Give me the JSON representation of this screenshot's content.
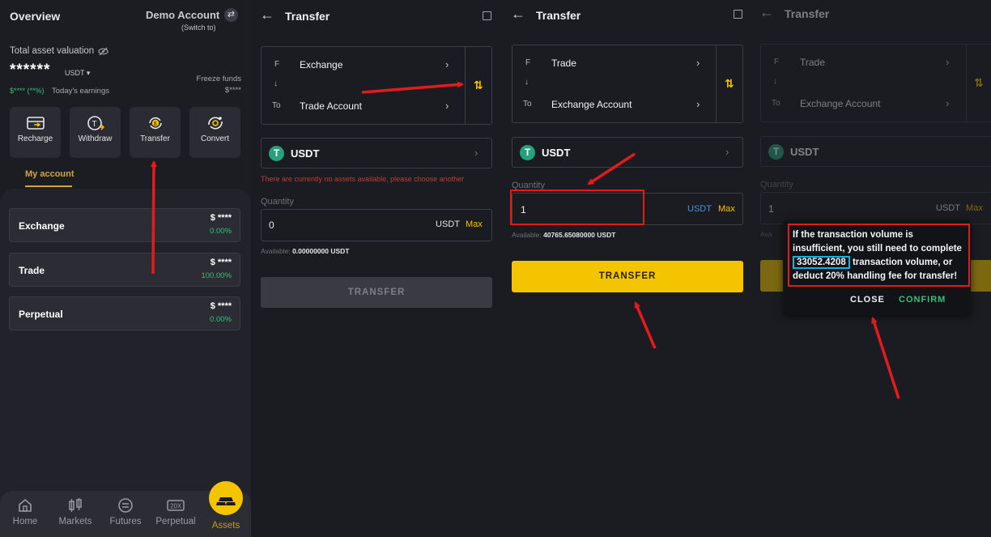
{
  "overview": {
    "title": "Overview",
    "account_name": "Demo Account",
    "switch_label": "(Switch to)",
    "total_label": "Total asset valuation",
    "total_value": "******",
    "currency": "USDT",
    "earnings_value": "$**** (**%)",
    "earnings_label": "Today's earnings",
    "freeze_label": "Freeze funds",
    "freeze_value": "$****",
    "actions": [
      "Recharge",
      "Withdraw",
      "Transfer",
      "Convert"
    ],
    "my_account_tab": "My account",
    "accounts": [
      {
        "name": "Exchange",
        "amount": "$ ****",
        "pct": "0.00%"
      },
      {
        "name": "Trade",
        "amount": "$ ****",
        "pct": "100.00%"
      },
      {
        "name": "Perpetual",
        "amount": "$ ****",
        "pct": "0.00%"
      }
    ],
    "nav": [
      "Home",
      "Markets",
      "Futures",
      "Perpetual",
      "Assets"
    ]
  },
  "transfer1": {
    "title": "Transfer",
    "from_label": "F",
    "to_label": "To",
    "from_account": "Exchange",
    "to_account": "Trade Account",
    "coin": "USDT",
    "error": "There are currently no assets available, please choose another",
    "quantity_label": "Quantity",
    "quantity_value": "0",
    "unit": "USDT",
    "max": "Max",
    "available_label": "Available:",
    "available_value": "0.00000000 USDT",
    "button": "TRANSFER"
  },
  "transfer2": {
    "title": "Transfer",
    "from_label": "F",
    "to_label": "To",
    "from_account": "Trade",
    "to_account": "Exchange Account",
    "coin": "USDT",
    "quantity_label": "Quantity",
    "quantity_value": "1",
    "unit": "USDT",
    "max": "Max",
    "available_label": "Available:",
    "available_value": "40765.65080000 USDT",
    "button": "TRANSFER"
  },
  "transfer3": {
    "title": "Transfer",
    "from_label": "F",
    "to_label": "To",
    "from_account": "Trade",
    "to_account": "Exchange Account",
    "coin": "USDT",
    "quantity_label": "Quantity",
    "quantity_value": "1",
    "unit": "USDT",
    "max": "Max",
    "available_label": "Ava",
    "dialog": {
      "line1": "If the transaction volume is insufficient, you still need to complete",
      "volume": "33052.4208",
      "line2": "transaction volume, or deduct 20% handling fee for transfer!",
      "close": "CLOSE",
      "confirm": "CONFIRM"
    }
  },
  "colors": {
    "accent": "#f5c400",
    "positive": "#35c07a",
    "error": "#c33a3a",
    "annotation": "#e21c1c",
    "highlight": "#12b2e5"
  }
}
